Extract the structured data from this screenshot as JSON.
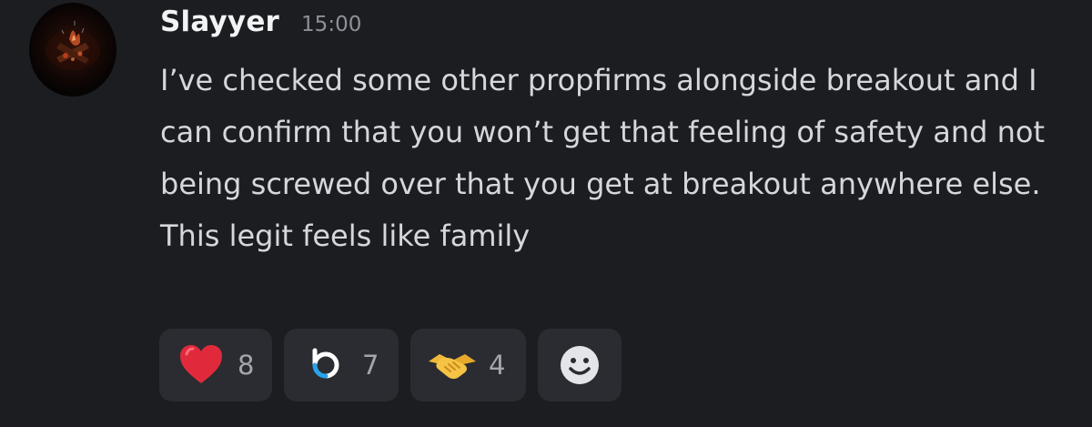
{
  "message": {
    "username": "Slayyer",
    "timestamp": "15:00",
    "text": "I’ve checked some other propfirms alongside breakout and I can confirm that you won’t get that feeling of safety and not being screwed over that you get at breakout anywhere else. This legit feels like family"
  },
  "reactions": [
    {
      "emoji": "heart-icon",
      "count": "8"
    },
    {
      "emoji": "breakout-logo-icon",
      "count": "7"
    },
    {
      "emoji": "handshake-icon",
      "count": "4"
    }
  ],
  "colors": {
    "background": "#1c1d21",
    "username": "#f2f3f5",
    "text": "#d6d7db",
    "timestamp": "#8e9099",
    "reaction_bg": "#2a2c31",
    "heart": "#e02a3c",
    "breakout_blue": "#2aa3e8"
  }
}
